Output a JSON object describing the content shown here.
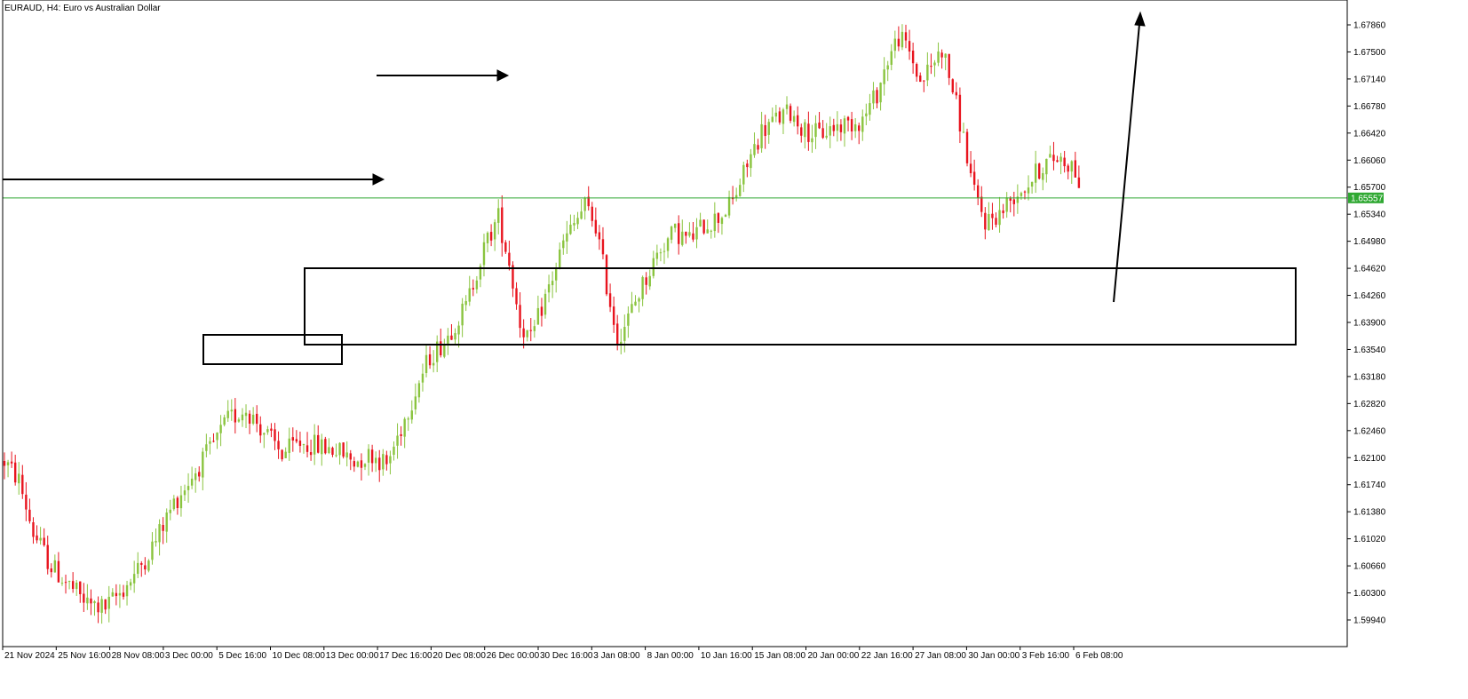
{
  "header": {
    "symbol_title": "EURAUD, H4:  Euro vs Australian Dollar"
  },
  "colors": {
    "bull": "#8ac43f",
    "bear": "#e8141e",
    "current_price_line": "#2fa832",
    "frame": "#000000",
    "background": "#ffffff"
  },
  "current_price": {
    "value": 1.65557,
    "label": "1.65557"
  },
  "chart_data": {
    "type": "candlestick",
    "title": "EURAUD, H4:  Euro vs Australian Dollar",
    "ylim": [
      1.5925,
      1.6825
    ],
    "y_ticks": [
      "1.67860",
      "1.67500",
      "1.67140",
      "1.66780",
      "1.66420",
      "1.66060",
      "1.65700",
      "1.65340",
      "1.64980",
      "1.64620",
      "1.64260",
      "1.63900",
      "1.63540",
      "1.63180",
      "1.62820",
      "1.62460",
      "1.62100",
      "1.61740",
      "1.61380",
      "1.61020",
      "1.60660",
      "1.60300",
      "1.59940"
    ],
    "x_ticks": [
      "21 Nov 2024",
      "25 Nov 16:00",
      "28 Nov 08:00",
      "3 Dec 00:00",
      "5 Dec 16:00",
      "10 Dec 08:00",
      "13 Dec 00:00",
      "17 Dec 16:00",
      "20 Dec 08:00",
      "26 Dec 00:00",
      "30 Dec 16:00",
      "3 Jan 08:00",
      "8 Jan 00:00",
      "10 Jan 16:00",
      "15 Jan 08:00",
      "20 Jan 00:00",
      "22 Jan 16:00",
      "27 Jan 08:00",
      "30 Jan 00:00",
      "3 Feb 16:00",
      "6 Feb 08:00"
    ],
    "x_tick_count": 21,
    "candle_count": 299,
    "grid": false,
    "anchor_path": [
      [
        0,
        1.6205
      ],
      [
        4,
        1.618
      ],
      [
        8,
        1.611
      ],
      [
        13,
        1.6065
      ],
      [
        18,
        1.604
      ],
      [
        23,
        1.6015
      ],
      [
        28,
        1.601
      ],
      [
        32,
        1.603
      ],
      [
        37,
        1.606
      ],
      [
        42,
        1.61
      ],
      [
        47,
        1.615
      ],
      [
        52,
        1.6185
      ],
      [
        57,
        1.622
      ],
      [
        62,
        1.626
      ],
      [
        67,
        1.6275
      ],
      [
        72,
        1.6245
      ],
      [
        77,
        1.6215
      ],
      [
        82,
        1.623
      ],
      [
        87,
        1.6225
      ],
      [
        92,
        1.622
      ],
      [
        97,
        1.6205
      ],
      [
        102,
        1.6215
      ],
      [
        106,
        1.62
      ],
      [
        110,
        1.625
      ],
      [
        114,
        1.63
      ],
      [
        118,
        1.6345
      ],
      [
        122,
        1.6365
      ],
      [
        125,
        1.639
      ],
      [
        128,
        1.641
      ],
      [
        131,
        1.646
      ],
      [
        134,
        1.65
      ],
      [
        137,
        1.653
      ],
      [
        140,
        1.647
      ],
      [
        143,
        1.639
      ],
      [
        146,
        1.6365
      ],
      [
        149,
        1.641
      ],
      [
        152,
        1.645
      ],
      [
        155,
        1.6495
      ],
      [
        158,
        1.652
      ],
      [
        161,
        1.6545
      ],
      [
        164,
        1.652
      ],
      [
        167,
        1.644
      ],
      [
        170,
        1.637
      ],
      [
        173,
        1.6395
      ],
      [
        176,
        1.643
      ],
      [
        179,
        1.646
      ],
      [
        182,
        1.649
      ],
      [
        186,
        1.651
      ],
      [
        190,
        1.65
      ],
      [
        194,
        1.652
      ],
      [
        198,
        1.653
      ],
      [
        202,
        1.655
      ],
      [
        206,
        1.66
      ],
      [
        210,
        1.6645
      ],
      [
        214,
        1.666
      ],
      [
        218,
        1.667
      ],
      [
        222,
        1.6645
      ],
      [
        226,
        1.664
      ],
      [
        230,
        1.665
      ],
      [
        234,
        1.6655
      ],
      [
        238,
        1.666
      ],
      [
        242,
        1.6695
      ],
      [
        245,
        1.674
      ],
      [
        248,
        1.677
      ],
      [
        251,
        1.675
      ],
      [
        254,
        1.671
      ],
      [
        257,
        1.673
      ],
      [
        260,
        1.6755
      ],
      [
        263,
        1.67
      ],
      [
        266,
        1.6635
      ],
      [
        269,
        1.656
      ],
      [
        272,
        1.6525
      ],
      [
        276,
        1.6535
      ],
      [
        280,
        1.656
      ],
      [
        284,
        1.6575
      ],
      [
        288,
        1.66
      ],
      [
        292,
        1.661
      ],
      [
        296,
        1.66
      ],
      [
        299,
        1.6565
      ]
    ],
    "annotations": [
      {
        "type": "arrow",
        "label": "arrow-1"
      },
      {
        "type": "arrow",
        "label": "arrow-2"
      },
      {
        "type": "arrow",
        "label": "arrow-3"
      },
      {
        "type": "box",
        "label": "zone-small"
      },
      {
        "type": "box",
        "label": "zone-large"
      }
    ]
  }
}
